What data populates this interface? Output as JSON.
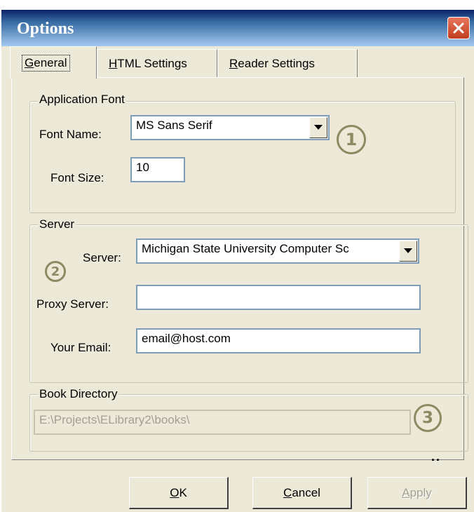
{
  "window": {
    "title": "Options"
  },
  "tabs": [
    {
      "label": "General",
      "active": true
    },
    {
      "label": "HTML Settings",
      "active": false
    },
    {
      "label": "Reader Settings",
      "active": false
    }
  ],
  "application_font": {
    "legend": "Application Font",
    "font_name_label": "Font Name:",
    "font_name_value": "MS Sans Serif",
    "font_size_label": "Font Size:",
    "font_size_value": "10",
    "badge": "1"
  },
  "server": {
    "legend": "Server",
    "server_label": "Server:",
    "server_value": "Michigan State University Computer Sc",
    "proxy_label": "Proxy Server:",
    "proxy_value": "",
    "email_label": "Your Email:",
    "email_value": "email@host.com",
    "badge": "2"
  },
  "book_directory": {
    "legend": "Book Directory",
    "path_value": "E:\\Projects\\ELibrary2\\books\\",
    "browse_label": "..",
    "badge": "3"
  },
  "buttons": {
    "ok": "OK",
    "cancel": "Cancel",
    "apply": "Apply"
  },
  "icons": {
    "close": "close-icon",
    "dropdown": "chevron-down-icon"
  },
  "colors": {
    "titlebar": "#0a246a",
    "close": "#c23d1f",
    "badge": "#8c8a62"
  }
}
